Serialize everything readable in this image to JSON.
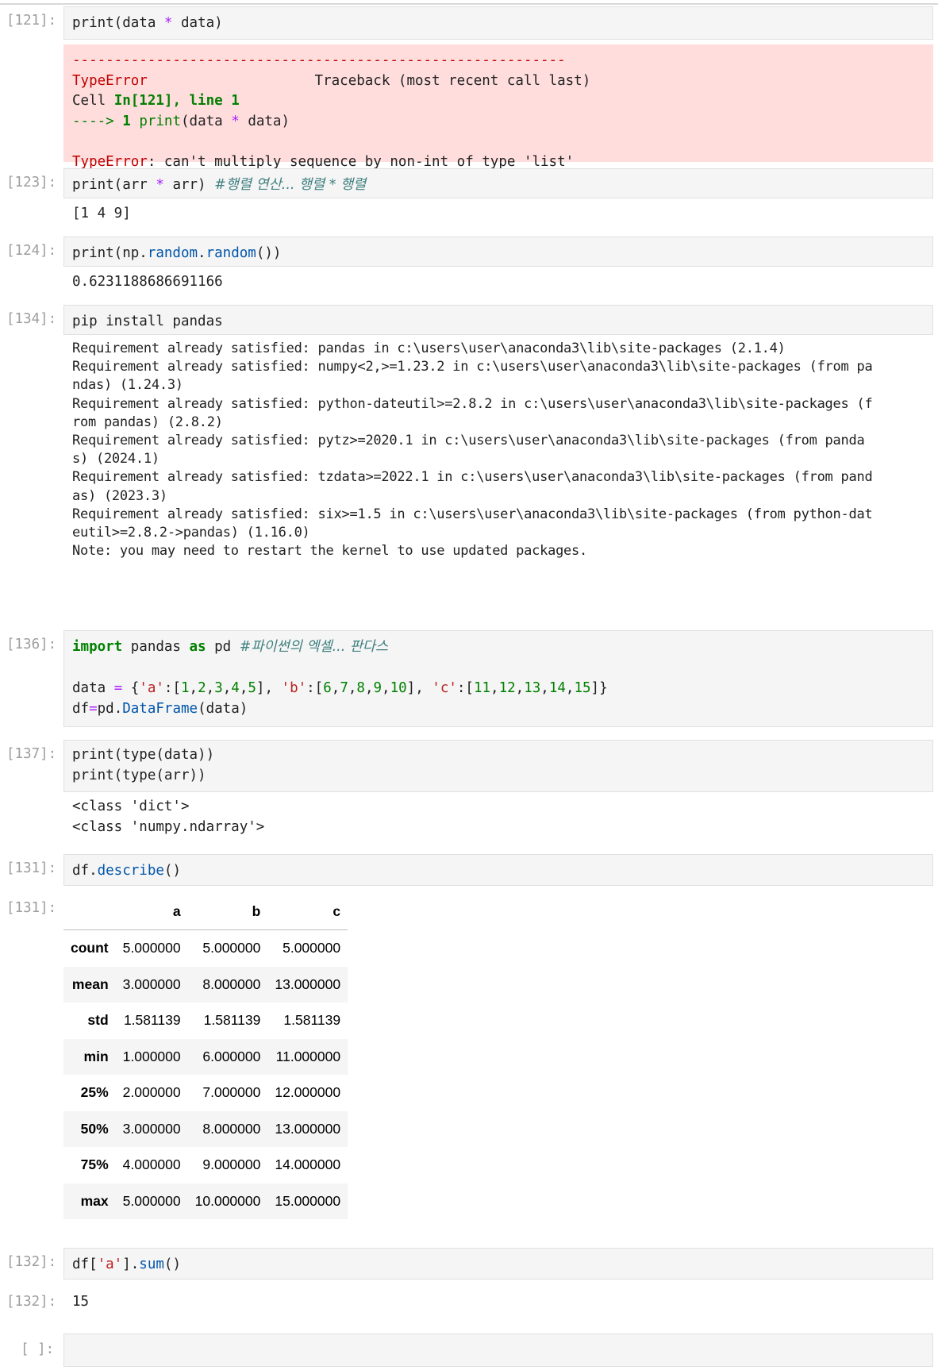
{
  "cells": [
    {
      "prompt": "[121]:",
      "code": "print(data * data)",
      "traceback": {
        "dashes": "-----------------------------------------------------------",
        "error_name": "TypeError",
        "header_right": "Traceback (most recent call last)",
        "cell_prefix": "Cell ",
        "cell_ref": "In[121], line 1",
        "arrow": "---->",
        "line_no": "1",
        "arrow_code": "print(data * data)",
        "error_message": ": can't multiply sequence by non-int of type 'list'"
      }
    },
    {
      "prompt": "[123]:",
      "code": "print(arr * arr) #행렬 연산... 행렬 * 행렬",
      "output": "[1 4 9]"
    },
    {
      "prompt": "[124]:",
      "code": "print(np.random.random())",
      "output": "0.6231188686691166"
    },
    {
      "prompt": "[134]:",
      "code": "pip install pandas",
      "output_lines": [
        "Requirement already satisfied: pandas in c:\\users\\user\\anaconda3\\lib\\site-packages (2.1.4)",
        "Requirement already satisfied: numpy<2,>=1.23.2 in c:\\users\\user\\anaconda3\\lib\\site-packages (from pa",
        "ndas) (1.24.3)",
        "Requirement already satisfied: python-dateutil>=2.8.2 in c:\\users\\user\\anaconda3\\lib\\site-packages (f",
        "rom pandas) (2.8.2)",
        "Requirement already satisfied: pytz>=2020.1 in c:\\users\\user\\anaconda3\\lib\\site-packages (from panda",
        "s) (2024.1)",
        "Requirement already satisfied: tzdata>=2022.1 in c:\\users\\user\\anaconda3\\lib\\site-packages (from pand",
        "as) (2023.3)",
        "Requirement already satisfied: six>=1.5 in c:\\users\\user\\anaconda3\\lib\\site-packages (from python-dat",
        "eutil>=2.8.2->pandas) (1.16.0)",
        "Note: you may need to restart the kernel to use updated packages."
      ]
    },
    {
      "prompt": "[136]:",
      "code_lines": [
        "import pandas as pd #파이썬의 엑셀... 판다스",
        "",
        "data = {'a':[1,2,3,4,5], 'b':[6,7,8,9,10], 'c':[11,12,13,14,15]}",
        "df=pd.DataFrame(data)"
      ]
    },
    {
      "prompt": "[137]:",
      "code_lines": [
        "print(type(data))",
        "print(type(arr))"
      ],
      "output_lines": [
        "<class 'dict'>",
        "<class 'numpy.ndarray'>"
      ]
    },
    {
      "prompt": "[131]:",
      "code": "df.describe()",
      "output_prompt": "[131]:",
      "table": {
        "columns": [
          "",
          "a",
          "b",
          "c"
        ],
        "rows": [
          [
            "count",
            "5.000000",
            "5.000000",
            "5.000000"
          ],
          [
            "mean",
            "3.000000",
            "8.000000",
            "13.000000"
          ],
          [
            "std",
            "1.581139",
            "1.581139",
            "1.581139"
          ],
          [
            "min",
            "1.000000",
            "6.000000",
            "11.000000"
          ],
          [
            "25%",
            "2.000000",
            "7.000000",
            "12.000000"
          ],
          [
            "50%",
            "3.000000",
            "8.000000",
            "13.000000"
          ],
          [
            "75%",
            "4.000000",
            "9.000000",
            "14.000000"
          ],
          [
            "max",
            "5.000000",
            "10.000000",
            "15.000000"
          ]
        ]
      }
    },
    {
      "prompt": "[132]:",
      "code": "df['a'].sum()",
      "output_prompt": "[132]:",
      "output": "15"
    },
    {
      "prompt": "[ ]:",
      "code": ""
    }
  ]
}
